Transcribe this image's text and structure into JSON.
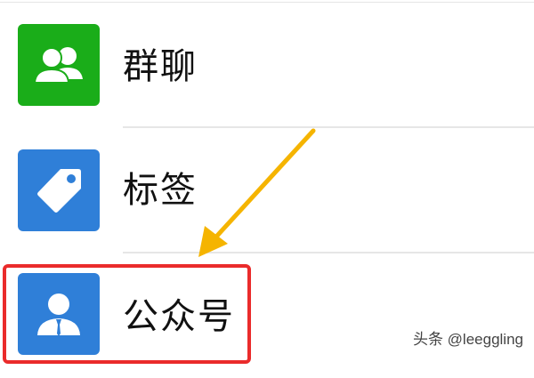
{
  "list": {
    "items": [
      {
        "label": "群聊",
        "icon": "group-chat-icon",
        "tile_color": "#1aad19"
      },
      {
        "label": "标签",
        "icon": "tag-icon",
        "tile_color": "#2f7fd8"
      },
      {
        "label": "公众号",
        "icon": "official-account-icon",
        "tile_color": "#2f7fd8"
      }
    ]
  },
  "annotation": {
    "arrow_color": "#f5b400",
    "highlight_color": "#ea2b2b"
  },
  "watermark": {
    "text": "头条 @leeggling"
  }
}
